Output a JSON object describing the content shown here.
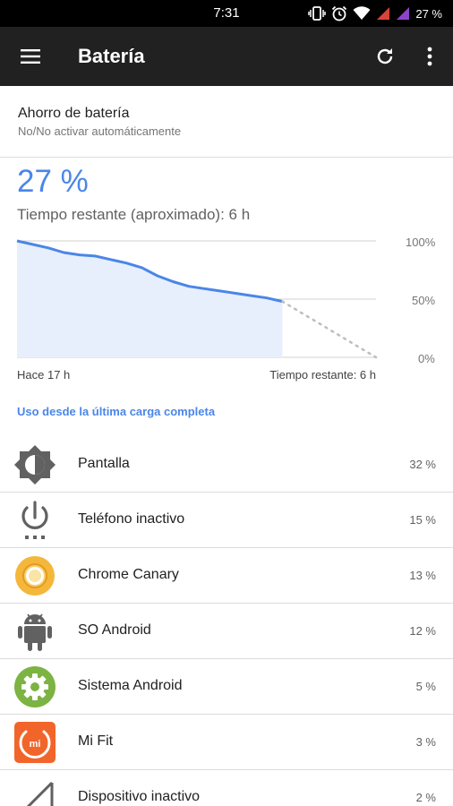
{
  "status_bar": {
    "time": "7:31",
    "battery_text": "27 %"
  },
  "app_bar": {
    "title": "Batería",
    "menu_icon": "menu-icon",
    "refresh_icon": "refresh-icon",
    "more_icon": "more-vert-icon",
    "color": "#212121"
  },
  "battery_saver": {
    "title": "Ahorro de batería",
    "subtitle": "No/No activar automáticamente"
  },
  "summary": {
    "percent": "27 %",
    "remaining": "Tiempo restante (aproximado): 6 h"
  },
  "chart_data": {
    "type": "area",
    "y_ticks": [
      "100%",
      "50%",
      "0%"
    ],
    "ylim": [
      0,
      100
    ],
    "x_label_start": "Hace 17 h",
    "x_label_end": "Tiempo restante: 6 h",
    "x_range_hours": [
      -17,
      6
    ],
    "series": [
      {
        "x": [
          -17,
          -16,
          -15,
          -14,
          -13,
          -12,
          -11,
          -10,
          -9,
          -8,
          -7,
          -6,
          -5,
          -4,
          -3,
          -2,
          -1,
          0
        ],
        "y": [
          100,
          97,
          94,
          90,
          88,
          87,
          84,
          81,
          77,
          70,
          65,
          61,
          59,
          57,
          55,
          53,
          51,
          48
        ]
      }
    ],
    "projection": {
      "x": [
        0,
        6
      ],
      "y": [
        27,
        0
      ]
    },
    "line_color": "#4a86e8",
    "projection_color": "#bdbdbd",
    "fill_color": "#e8effc"
  },
  "usage_section": {
    "label": "Uso desde la última carga completa"
  },
  "usage": [
    {
      "name": "Pantalla",
      "percent": "32 %",
      "icon": "brightness-icon"
    },
    {
      "name": "Teléfono inactivo",
      "percent": "15 %",
      "icon": "power-idle-icon"
    },
    {
      "name": "Chrome Canary",
      "percent": "13 %",
      "icon": "chrome-canary-icon"
    },
    {
      "name": "SO Android",
      "percent": "12 %",
      "icon": "android-robot-icon"
    },
    {
      "name": "Sistema Android",
      "percent": "5 %",
      "icon": "android-system-gear-icon"
    },
    {
      "name": "Mi Fit",
      "percent": "3 %",
      "icon": "mi-fit-icon"
    },
    {
      "name": "Dispositivo inactivo",
      "percent": "2 %",
      "icon": "signal-idle-icon"
    }
  ],
  "colors": {
    "accent": "#4a86e8",
    "chrome_canary": "#f4b73b",
    "android_system": "#7cb342",
    "mi_fit": "#f2652a",
    "icon_gray": "#616161"
  }
}
